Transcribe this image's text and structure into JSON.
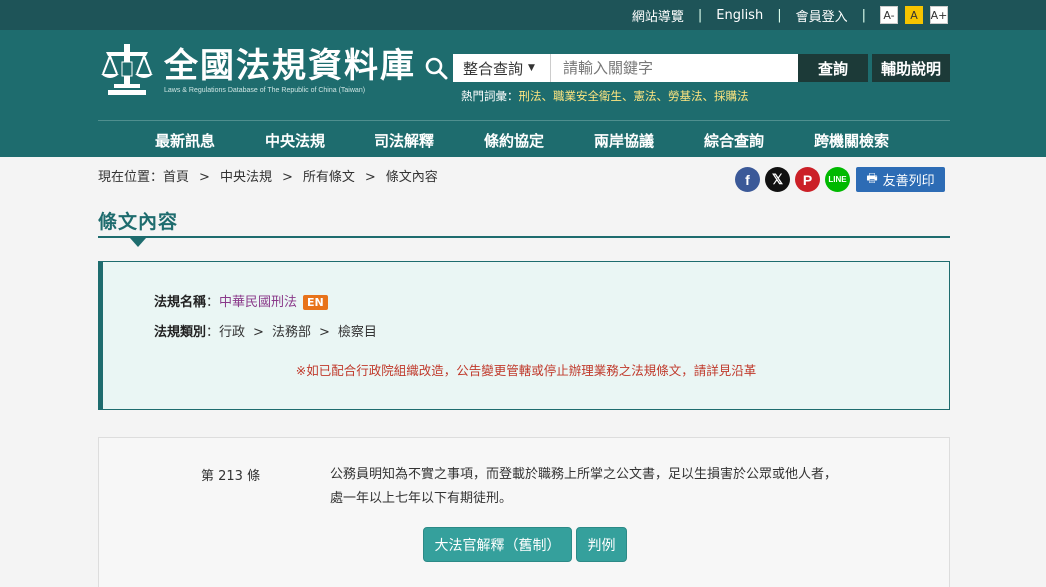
{
  "topbar": {
    "sitemap": "網站導覽",
    "english": "English",
    "login": "會員登入",
    "font_small": "A-",
    "font_mid": "A",
    "font_large": "A+"
  },
  "header": {
    "logo_title": "全國法規資料庫",
    "logo_subtitle": "Laws & Regulations Database of The Republic of China (Taiwan)",
    "search_scope": "整合查詢",
    "search_placeholder": "請輸入關鍵字",
    "search_button": "查詢",
    "help_button": "輔助說明",
    "hot_label": "熱門詞彙：",
    "hot_keywords": [
      "刑法",
      "職業安全衛生",
      "憲法",
      "勞基法",
      "採購法"
    ],
    "hot_separator": "、"
  },
  "nav": {
    "items": [
      "最新訊息",
      "中央法規",
      "司法解釋",
      "條約協定",
      "兩岸協議",
      "綜合查詢",
      "跨機關檢索"
    ]
  },
  "breadcrumb": {
    "prefix": "現在位置：",
    "items": [
      "首頁",
      "中央法規",
      "所有條文",
      "條文內容"
    ],
    "separator": ">"
  },
  "share": {
    "facebook": "f",
    "x": "𝕏",
    "plurk": "P",
    "line": "LINE",
    "print": "友善列印"
  },
  "page_title": "條文內容",
  "info": {
    "name_label": "法規名稱",
    "colon": "：",
    "law_name": "中華民國刑法",
    "en_badge": "EN",
    "category_label": "法規類別",
    "categories": [
      "行政",
      "法務部",
      "檢察目"
    ],
    "category_separator": ">",
    "notice": "※如已配合行政院組織改造，公告變更管轄或停止辦理業務之法規條文，請詳見沿革"
  },
  "article": {
    "number": "第 213 條",
    "text_line1": "公務員明知為不實之事項，而登載於職務上所掌之公文書，足以生損害於公眾或他人者，",
    "text_line2": "處一年以上七年以下有期徒刑。",
    "button_interpretation": "大法官解釋（舊制）",
    "button_judgment": "判例"
  },
  "colors": {
    "header_bg": "#1e6c6e",
    "topbar_bg": "#1e5458",
    "accent": "#1e6c6e",
    "notice_red": "#c0392b",
    "hot_keyword": "#ffe680",
    "button_teal": "#35a09c"
  }
}
